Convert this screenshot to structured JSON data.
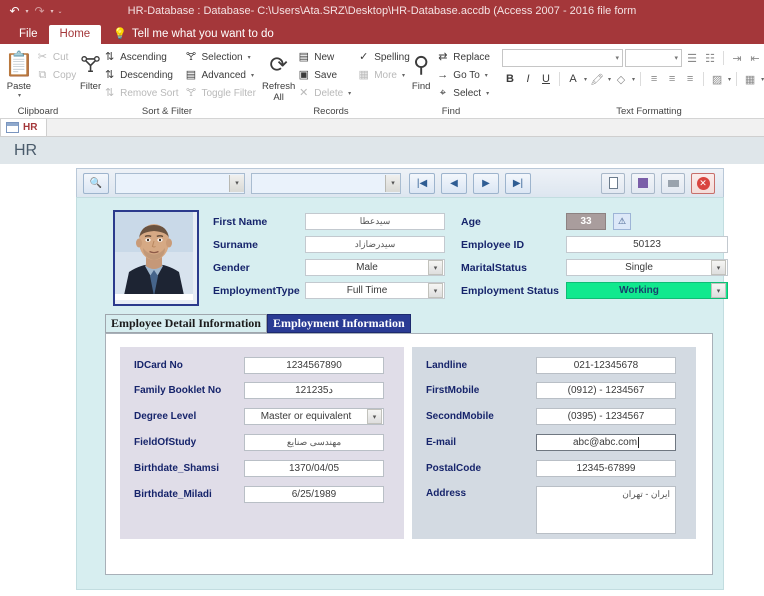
{
  "titlebar": {
    "title": "HR-Database : Database- C:\\Users\\Ata.SRZ\\Desktop\\HR-Database.accdb (Access 2007 - 2016 file form",
    "qat": [
      {
        "name": "undo-icon",
        "glyph": "↶"
      },
      {
        "name": "redo-icon",
        "glyph": "↷"
      },
      {
        "name": "customize-quick-access-toolbar-icon",
        "glyph": "⌄"
      }
    ]
  },
  "ribbon": {
    "tabs": [
      {
        "label": "File",
        "active": false
      },
      {
        "label": "Home",
        "active": true
      }
    ],
    "tell_me": "Tell me what you want to do",
    "groups": [
      {
        "label": "Clipboard",
        "big": [
          {
            "label": "Paste",
            "icon": "paste-icon",
            "glyph": "📋",
            "disabled": false
          }
        ],
        "small": [
          {
            "label": "Cut",
            "icon": "cut-icon",
            "glyph": "✂",
            "disabled": true
          },
          {
            "label": "Copy",
            "icon": "copy-icon",
            "glyph": "⧉",
            "disabled": true
          }
        ]
      },
      {
        "label": "Sort & Filter",
        "big": [
          {
            "label": "Filter",
            "icon": "filter-icon",
            "glyph": "▼",
            "disabled": false
          }
        ],
        "small": [
          {
            "label": "Ascending",
            "icon": "sort-ascending-icon",
            "glyph": "A↓",
            "disabled": false
          },
          {
            "label": "Descending",
            "icon": "sort-descending-icon",
            "glyph": "Z↓",
            "disabled": false
          },
          {
            "label": "Remove Sort",
            "icon": "remove-sort-icon",
            "glyph": "A↓",
            "disabled": true
          }
        ],
        "small2": [
          {
            "label": "Selection",
            "icon": "selection-icon",
            "glyph": "▼",
            "disabled": false,
            "caret": true
          },
          {
            "label": "Advanced",
            "icon": "advanced-filter-icon",
            "glyph": "▤",
            "disabled": false,
            "caret": true
          },
          {
            "label": "Toggle Filter",
            "icon": "toggle-filter-icon",
            "glyph": "▽",
            "disabled": true
          }
        ]
      },
      {
        "label": "Records",
        "big": [
          {
            "label": "Refresh All",
            "icon": "refresh-all-icon",
            "glyph": "⟳",
            "disabled": false,
            "caret": true
          }
        ],
        "small": [
          {
            "label": "New",
            "icon": "new-record-icon",
            "glyph": "▤",
            "disabled": false
          },
          {
            "label": "Save",
            "icon": "save-record-icon",
            "glyph": "▣",
            "disabled": false
          },
          {
            "label": "Delete",
            "icon": "delete-record-icon",
            "glyph": "✕",
            "disabled": true,
            "caret": true
          }
        ],
        "small2": [
          {
            "label": "Spelling",
            "icon": "spelling-icon",
            "glyph": "✓",
            "disabled": false
          },
          {
            "label": "More",
            "icon": "more-icon",
            "glyph": "▦",
            "disabled": true,
            "caret": true
          }
        ]
      },
      {
        "label": "Find",
        "big": [
          {
            "label": "Find",
            "icon": "find-icon",
            "glyph": "⚲",
            "disabled": false
          }
        ],
        "small": [
          {
            "label": "Replace",
            "icon": "replace-icon",
            "glyph": "ab",
            "disabled": false
          },
          {
            "label": "Go To",
            "icon": "go-to-icon",
            "glyph": "→",
            "disabled": false,
            "caret": true
          },
          {
            "label": "Select",
            "icon": "select-icon",
            "glyph": "⌖",
            "disabled": false,
            "caret": true
          }
        ]
      },
      {
        "label": "Text Formatting",
        "font_name": "",
        "font_size": "",
        "buttons_row1": [
          {
            "icon": "bulleted-list-icon",
            "glyph": "☰"
          },
          {
            "icon": "numbered-list-icon",
            "glyph": "☷"
          },
          {
            "icon": "decrease-indent-icon",
            "glyph": "⇤"
          },
          {
            "icon": "increase-indent-icon",
            "glyph": "⇥"
          },
          {
            "icon": "rtl-text-direction-icon",
            "glyph": "¶"
          }
        ],
        "buttons_row2": [
          {
            "icon": "bold-icon",
            "glyph": "B"
          },
          {
            "icon": "italic-icon",
            "glyph": "I"
          },
          {
            "icon": "underline-icon",
            "glyph": "U"
          },
          {
            "icon": "font-color-icon",
            "glyph": "A"
          },
          {
            "icon": "text-highlight-color-icon",
            "glyph": "ab"
          },
          {
            "icon": "background-color-icon",
            "glyph": "◇"
          },
          {
            "icon": "align-left-icon",
            "glyph": "≡"
          },
          {
            "icon": "align-center-icon",
            "glyph": "≡"
          },
          {
            "icon": "align-right-icon",
            "glyph": "≡"
          },
          {
            "icon": "alternate-row-color-icon",
            "glyph": "▨"
          },
          {
            "icon": "gridlines-icon",
            "glyph": "▦"
          }
        ]
      }
    ]
  },
  "object_tab": {
    "label": "HR",
    "icon": "form-object-icon"
  },
  "form_header": {
    "title": "HR"
  },
  "navbar": {
    "search_icon": "search-icon",
    "combo1_value": "",
    "combo2_value": "",
    "nav_buttons": [
      {
        "name": "first-record-button",
        "glyph": "|◀"
      },
      {
        "name": "previous-record-button",
        "glyph": "◀"
      },
      {
        "name": "next-record-button",
        "glyph": "▶"
      },
      {
        "name": "last-record-button",
        "glyph": "▶|"
      }
    ],
    "action_buttons": [
      {
        "name": "new-record-button",
        "glyph": "▯"
      },
      {
        "name": "save-record-button",
        "glyph": "▤"
      },
      {
        "name": "print-record-button",
        "glyph": "▭"
      },
      {
        "name": "close-form-button",
        "glyph": "✕"
      }
    ]
  },
  "record": {
    "photo_alt": "employee-photo",
    "left_fields": [
      {
        "label": "First Name",
        "value": "سیدعطا",
        "type": "text",
        "rtl": true
      },
      {
        "label": "Surname",
        "value": "سیدرضازاد",
        "type": "text",
        "rtl": true
      },
      {
        "label": "Gender",
        "value": "Male",
        "type": "combo"
      },
      {
        "label": "EmploymentType",
        "value": "Full Time",
        "type": "combo"
      }
    ],
    "right_fields": [
      {
        "label": "Age",
        "value": "33",
        "type": "readonly",
        "has_error_icon": true
      },
      {
        "label": "Employee ID",
        "value": "50123",
        "type": "text"
      },
      {
        "label": "MaritalStatus",
        "value": "Single",
        "type": "combo"
      },
      {
        "label": "Employment Status",
        "value": "Working",
        "type": "combo",
        "highlight": "#11e98e"
      }
    ]
  },
  "tabs": [
    {
      "label": "Employee Detail Information",
      "active": false
    },
    {
      "label": "Employment Information",
      "active": true
    }
  ],
  "panel_left": [
    {
      "label": "IDCard No",
      "value": "1234567890",
      "type": "text"
    },
    {
      "label": "Family Booklet No",
      "value": "12د1235",
      "type": "text"
    },
    {
      "label": "Degree Level",
      "value": "Master or equivalent",
      "type": "combo"
    },
    {
      "label": "FieldOfStudy",
      "value": "مهندسی صنایع",
      "type": "text",
      "rtl": true
    },
    {
      "label": "Birthdate_Shamsi",
      "value": "1370/04/05",
      "type": "text"
    },
    {
      "label": "Birthdate_Miladi",
      "value": "6/25/1989",
      "type": "text"
    }
  ],
  "panel_right": [
    {
      "label": "Landline",
      "value": "021-12345678",
      "type": "text"
    },
    {
      "label": "FirstMobile",
      "value": "(0912) - 1234567",
      "type": "text"
    },
    {
      "label": "SecondMobile",
      "value": "(0395) - 1234567",
      "type": "text"
    },
    {
      "label": "E-mail",
      "value": "abc@abc.com",
      "type": "text",
      "focused": true
    },
    {
      "label": "PostalCode",
      "value": "12345-67899",
      "type": "text"
    },
    {
      "label": "Address",
      "value": "ایران - تهران",
      "type": "textarea",
      "rtl": true
    }
  ],
  "colors": {
    "accent": "#a4373a",
    "label_blue": "#16246b",
    "pane_bg": "#d7eef0",
    "tab_active": "#2a3b94",
    "status_green": "#11e98e",
    "panel_left_bg": "#e0dde8",
    "panel_right_bg": "#d3dae2"
  }
}
